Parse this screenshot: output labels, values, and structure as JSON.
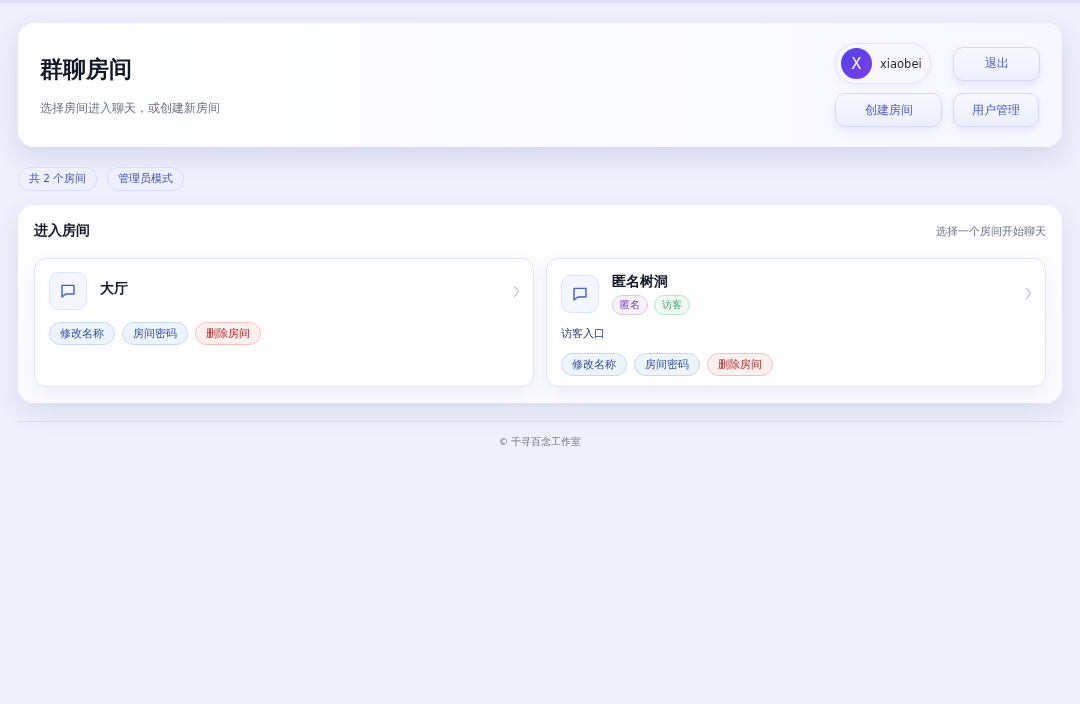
{
  "header": {
    "title": "群聊房间",
    "subtitle": "选择房间进入聊天，或创建新房间",
    "user": {
      "avatar_letter": "X",
      "name": "xiaobei"
    },
    "buttons": [
      {
        "label": "退出"
      },
      {
        "label": "创建房间"
      },
      {
        "label": "用户管理"
      }
    ]
  },
  "chips": [
    "共 2 个房间",
    "管理员模式"
  ],
  "rooms_panel": {
    "title": "进入房间",
    "hint": "选择一个房间开始聊天",
    "rooms": [
      {
        "name": "大厅",
        "actions": [
          {
            "label": "修改名称",
            "kind": "normal"
          },
          {
            "label": "房间密码",
            "kind": "normal"
          },
          {
            "label": "删除房间",
            "kind": "danger"
          }
        ]
      },
      {
        "name": "匿名树洞",
        "tags": [
          {
            "label": "匿名",
            "color": "#dcc6f7"
          },
          {
            "label": "访客",
            "color": "#b5e6c8"
          }
        ],
        "description": "访客入口",
        "actions": [
          {
            "label": "修改名称",
            "kind": "normal"
          },
          {
            "label": "房间密码",
            "kind": "normal"
          },
          {
            "label": "删除房间",
            "kind": "danger"
          }
        ]
      }
    ]
  },
  "footer": {
    "text": "© 千寻百念工作室"
  }
}
